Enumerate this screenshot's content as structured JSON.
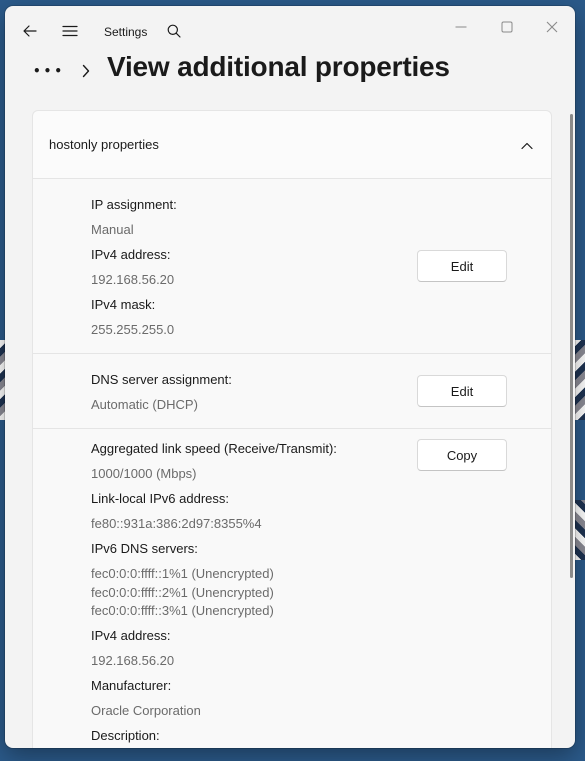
{
  "app": {
    "title": "Settings"
  },
  "header": {
    "more_label": "•••",
    "title": "View additional properties"
  },
  "card": {
    "title": "hostonly properties",
    "sections": [
      {
        "fields": [
          {
            "label": "IP assignment:",
            "value": "Manual"
          },
          {
            "label": "IPv4 address:",
            "value": "192.168.56.20"
          },
          {
            "label": "IPv4 mask:",
            "value": "255.255.255.0"
          }
        ],
        "button": "Edit"
      },
      {
        "fields": [
          {
            "label": "DNS server assignment:",
            "value": "Automatic (DHCP)"
          }
        ],
        "button": "Edit"
      },
      {
        "fields": [
          {
            "label": "Aggregated link speed (Receive/Transmit):",
            "value": "1000/1000 (Mbps)"
          },
          {
            "label": "Link-local IPv6 address:",
            "value": "fe80::931a:386:2d97:8355%4"
          },
          {
            "label": "IPv6 DNS servers:",
            "values": [
              "fec0:0:0:ffff::1%1 (Unencrypted)",
              "fec0:0:0:ffff::2%1 (Unencrypted)",
              "fec0:0:0:ffff::3%1 (Unencrypted)"
            ]
          },
          {
            "label": "IPv4 address:",
            "value": "192.168.56.20"
          },
          {
            "label": "Manufacturer:",
            "value": "Oracle Corporation"
          },
          {
            "label": "Description:"
          }
        ],
        "button": "Copy"
      }
    ]
  },
  "icons": {
    "back": "back-arrow-icon",
    "menu": "hamburger-menu-icon",
    "search": "search-icon",
    "minimize": "minimize-icon",
    "maximize": "maximize-icon",
    "close": "close-icon",
    "breadcrumb_separator": "chevron-right-icon",
    "collapse": "chevron-up-icon"
  }
}
